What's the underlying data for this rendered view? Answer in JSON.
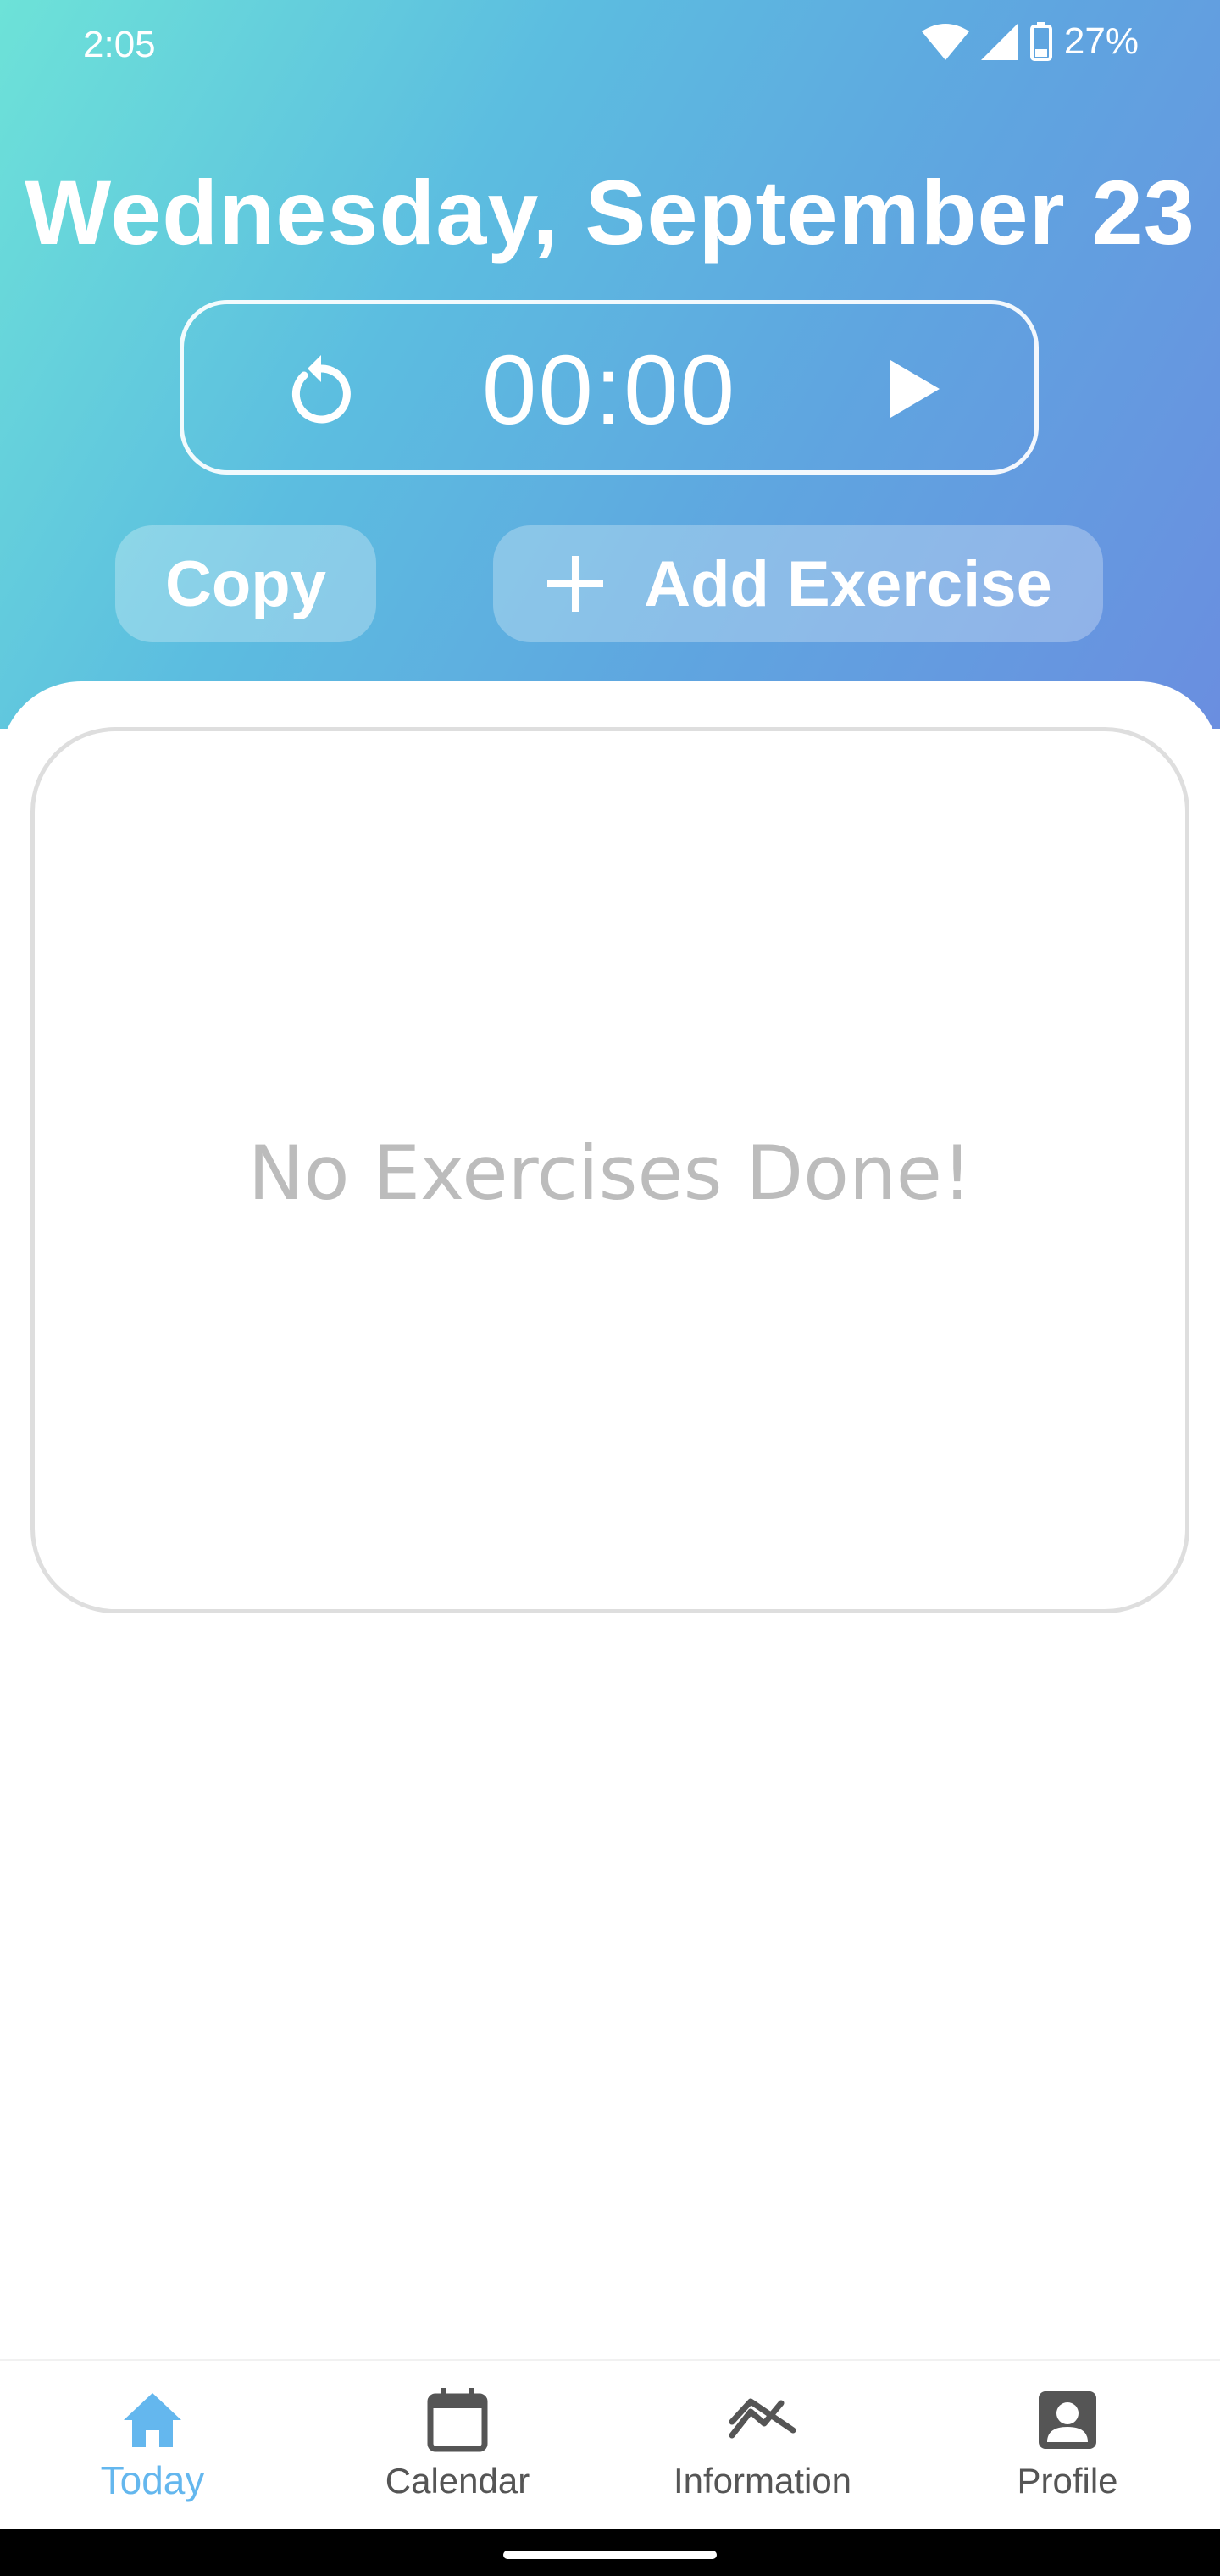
{
  "status_bar": {
    "time": "2:05",
    "battery": "27%"
  },
  "header": {
    "date": "Wednesday, September 23"
  },
  "timer": {
    "display": "00:00"
  },
  "actions": {
    "copy_label": "Copy",
    "add_exercise_label": "Add Exercise"
  },
  "exercises": {
    "empty_message": "No Exercises Done!"
  },
  "bottom_nav": {
    "items": [
      {
        "label": "Today",
        "icon": "home-icon",
        "active": true
      },
      {
        "label": "Calendar",
        "icon": "calendar-icon",
        "active": false
      },
      {
        "label": "Information",
        "icon": "trend-icon",
        "active": false
      },
      {
        "label": "Profile",
        "icon": "profile-icon",
        "active": false
      }
    ]
  },
  "colors": {
    "accent": "#64b7ee",
    "gradient_start": "#6de2d8",
    "gradient_end": "#6a8ee0",
    "muted_text": "#bcbcbc"
  }
}
